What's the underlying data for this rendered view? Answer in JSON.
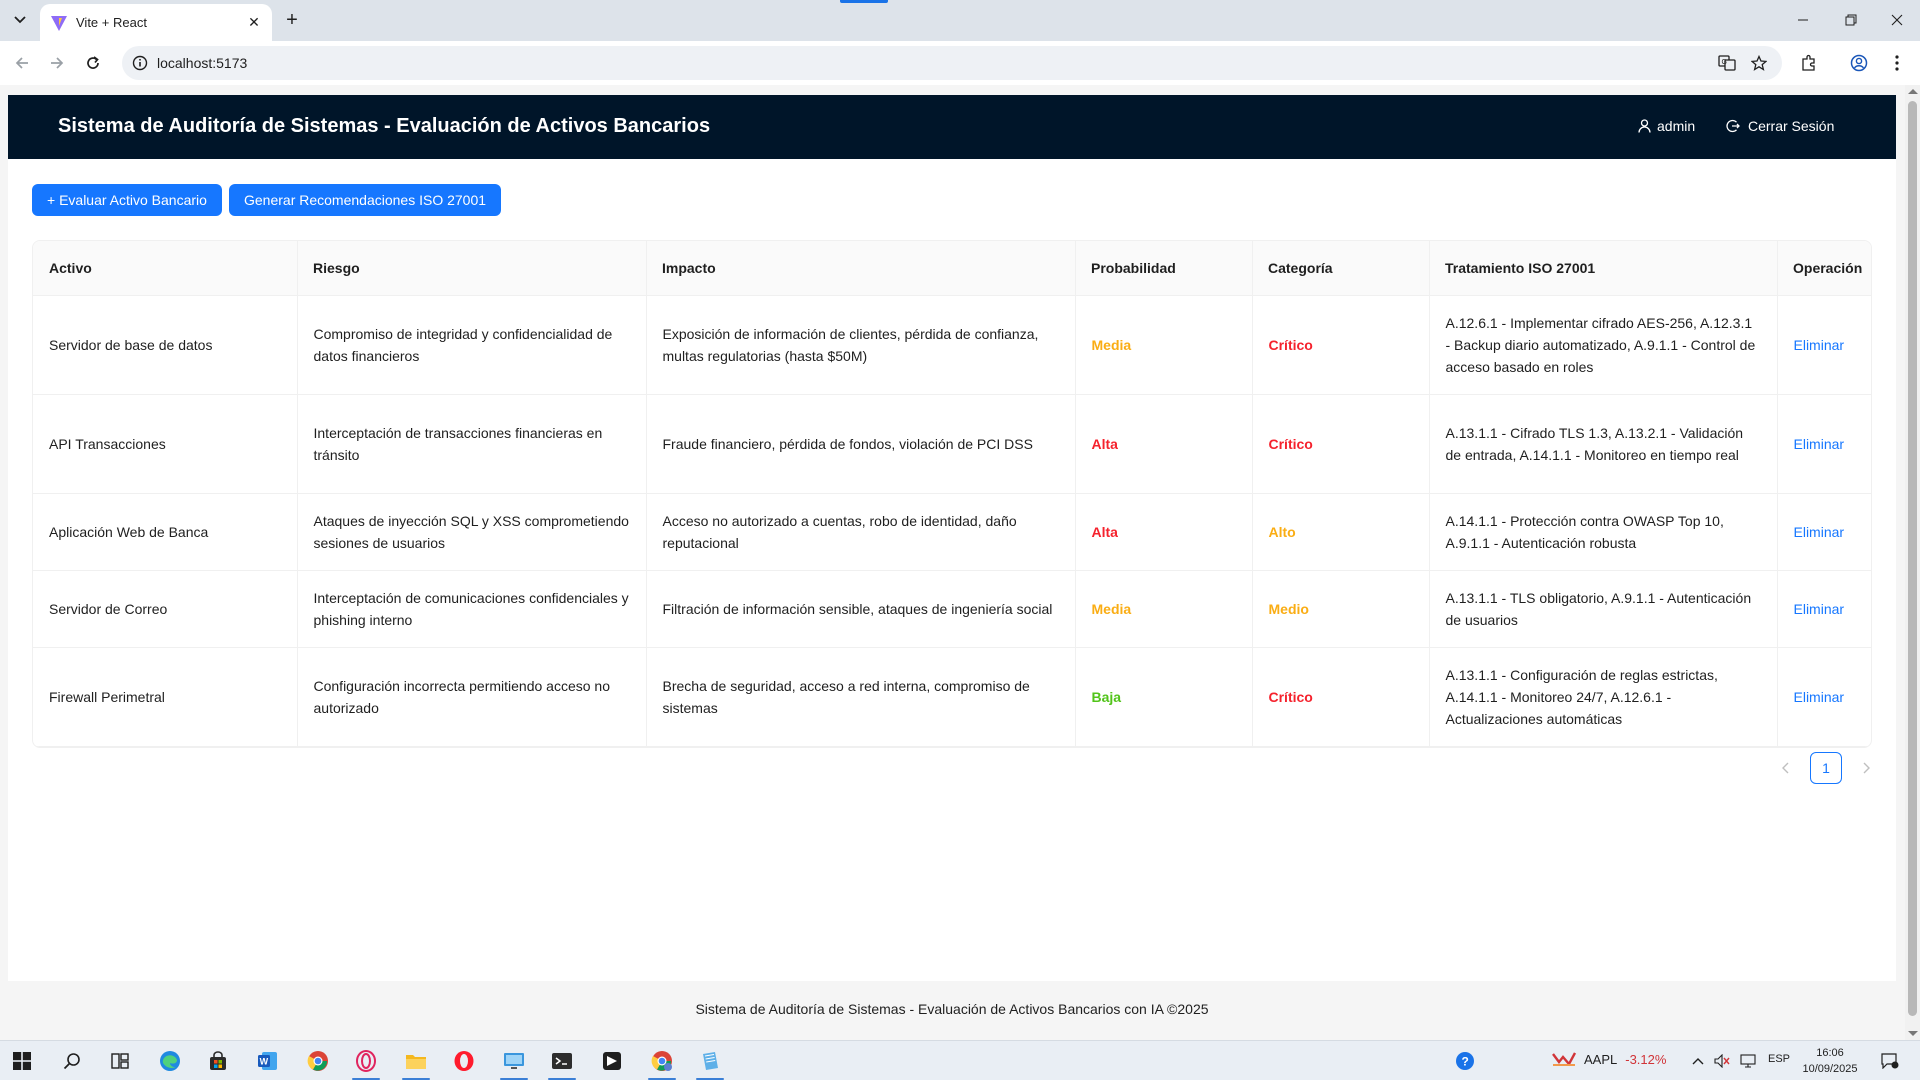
{
  "browser": {
    "tab_title": "Vite + React",
    "url": "localhost:5173"
  },
  "app": {
    "title": "Sistema de Auditoría de Sistemas - Evaluación de Activos Bancarios",
    "user": "admin",
    "logout_label": "Cerrar Sesión",
    "evaluate_button": "+ Evaluar Activo Bancario",
    "recommend_button": "Generar Recomendaciones ISO 27001",
    "footer": "Sistema de Auditoría de Sistemas - Evaluación de Activos Bancarios con IA ©2025"
  },
  "table": {
    "headers": [
      "Activo",
      "Riesgo",
      "Impacto",
      "Probabilidad",
      "Categoría",
      "Tratamiento ISO 27001",
      "Operación"
    ],
    "rows": [
      {
        "activo": "Servidor de base de datos",
        "riesgo": "Compromiso de integridad y confidencialidad de datos financieros",
        "impacto": "Exposición de información de clientes, pérdida de confianza, multas regulatorias (hasta $50M)",
        "probabilidad": "Media",
        "categoria": "Crítico",
        "tratamiento": "A.12.6.1 - Implementar cifrado AES-256, A.12.3.1 - Backup diario automatizado, A.9.1.1 - Control de acceso basado en roles",
        "operacion": "Eliminar"
      },
      {
        "activo": "API Transacciones",
        "riesgo": "Interceptación de transacciones financieras en tránsito",
        "impacto": "Fraude financiero, pérdida de fondos, violación de PCI DSS",
        "probabilidad": "Alta",
        "categoria": "Crítico",
        "tratamiento": "A.13.1.1 - Cifrado TLS 1.3, A.13.2.1 - Validación de entrada, A.14.1.1 - Monitoreo en tiempo real",
        "operacion": "Eliminar"
      },
      {
        "activo": "Aplicación Web de Banca",
        "riesgo": "Ataques de inyección SQL y XSS comprometiendo sesiones de usuarios",
        "impacto": "Acceso no autorizado a cuentas, robo de identidad, daño reputacional",
        "probabilidad": "Alta",
        "categoria": "Alto",
        "tratamiento": "A.14.1.1 - Protección contra OWASP Top 10, A.9.1.1 - Autenticación robusta",
        "operacion": "Eliminar"
      },
      {
        "activo": "Servidor de Correo",
        "riesgo": "Interceptación de comunicaciones confidenciales y phishing interno",
        "impacto": "Filtración de información sensible, ataques de ingeniería social",
        "probabilidad": "Media",
        "categoria": "Medio",
        "tratamiento": "A.13.1.1 - TLS obligatorio, A.9.1.1 - Autenticación de usuarios",
        "operacion": "Eliminar"
      },
      {
        "activo": "Firewall Perimetral",
        "riesgo": "Configuración incorrecta permitiendo acceso no autorizado",
        "impacto": "Brecha de seguridad, acceso a red interna, compromiso de sistemas",
        "probabilidad": "Baja",
        "categoria": "Crítico",
        "tratamiento": "A.13.1.1 - Configuración de reglas estrictas, A.14.1.1 - Monitoreo 24/7, A.12.6.1 - Actualizaciones automáticas",
        "operacion": "Eliminar"
      }
    ]
  },
  "pagination": {
    "current_page": "1"
  },
  "level_colors": {
    "Media": "#faad14",
    "Medio": "#faad14",
    "Alto": "#faad14",
    "Alta": "#f5222d",
    "Crítico": "#f5222d",
    "Baja": "#52c41a"
  },
  "taskbar": {
    "stock_symbol": "AAPL",
    "stock_change": "-3.12%",
    "language": "ESP",
    "time": "16:06",
    "date": "10/09/2025"
  }
}
